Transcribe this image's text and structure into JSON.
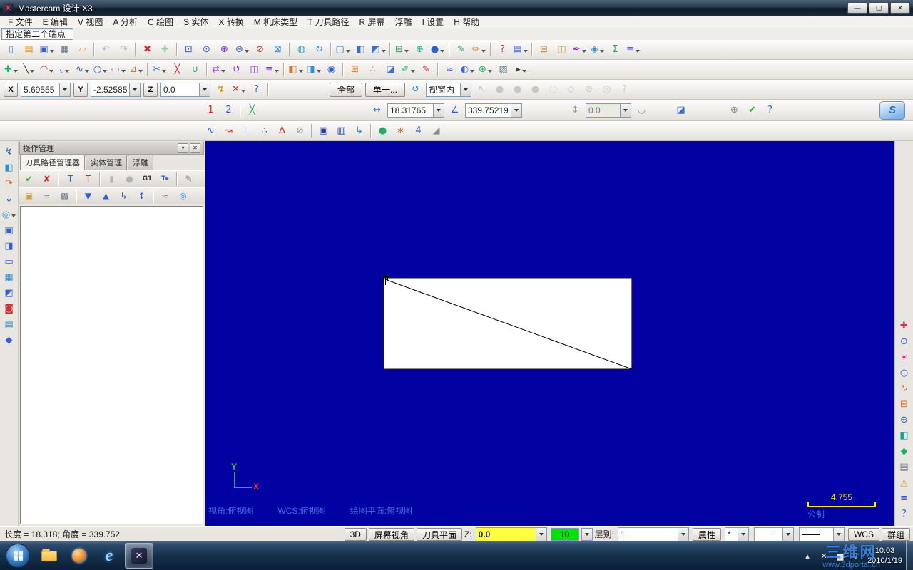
{
  "window": {
    "title": "Mastercam 设计 X3",
    "logo_glyph": "✕",
    "min_glyph": "—",
    "max_glyph": "▢",
    "close_glyph": "✕"
  },
  "menu": {
    "items": [
      "F 文件",
      "E 编辑",
      "V 视图",
      "A 分析",
      "C 绘图",
      "S 实体",
      "X 转换",
      "M 机床类型",
      "T 刀具路径",
      "R 屏幕",
      "浮雕",
      "I 设置",
      "H 帮助"
    ]
  },
  "prompt": {
    "text": "指定第二个端点"
  },
  "toolbars": {
    "standard": [
      {
        "name": "new-file-icon",
        "glyph": "▯",
        "color": "#6a86c2"
      },
      {
        "name": "open-file-icon",
        "glyph": "▤",
        "color": "#d79b3a"
      },
      {
        "name": "save-icon",
        "glyph": "▣",
        "color": "#3a5fd7",
        "drop": true
      },
      {
        "name": "print-icon",
        "glyph": "▦",
        "color": "#6b7b8c"
      },
      {
        "name": "file-merge-icon",
        "glyph": "▱",
        "color": "#c9a23a"
      },
      {
        "sep": true
      },
      {
        "name": "undo-icon",
        "glyph": "↶",
        "color": "#7a7a7a",
        "disabled": true
      },
      {
        "name": "redo-icon",
        "glyph": "↷",
        "color": "#7a7a7a",
        "disabled": true
      },
      {
        "sep": true
      },
      {
        "name": "delete-entities-icon",
        "glyph": "✖",
        "color": "#cc2a2a"
      },
      {
        "name": "undelete-icon",
        "glyph": "✚",
        "color": "#2fa05f",
        "disabled": true
      },
      {
        "sep": true
      },
      {
        "name": "zoom-window-icon",
        "glyph": "⊡",
        "color": "#2f5fd0"
      },
      {
        "name": "zoom-target-icon",
        "glyph": "⊙",
        "color": "#2f5fd0"
      },
      {
        "name": "zoom-in-icon",
        "glyph": "⊕",
        "color": "#7b2fd0"
      },
      {
        "name": "zoom-out-icon",
        "glyph": "⊖",
        "color": "#2f5fd0",
        "drop": true
      },
      {
        "name": "unzoom-icon",
        "glyph": "⊘",
        "color": "#d02f2f"
      },
      {
        "name": "zoom-fit-icon",
        "glyph": "⊠",
        "color": "#2f8fd0"
      },
      {
        "sep": true
      },
      {
        "name": "repaint-icon",
        "glyph": "◍",
        "color": "#2fa0d0"
      },
      {
        "name": "regenerate-icon",
        "glyph": "↻",
        "color": "#2f8fd0"
      },
      {
        "sep": true
      },
      {
        "name": "gview-top-icon",
        "glyph": "▢",
        "color": "#3a6fd0",
        "drop": true
      },
      {
        "name": "gview-front-icon",
        "glyph": "◧",
        "color": "#3a6fd0"
      },
      {
        "name": "gview-iso-icon",
        "glyph": "◩",
        "color": "#3a6fd0",
        "drop": true
      },
      {
        "sep": true
      },
      {
        "name": "planes-icon",
        "glyph": "⊞",
        "color": "#2fa05f",
        "drop": true
      },
      {
        "name": "wcs-globe-icon",
        "glyph": "⊕",
        "color": "#18b08a"
      },
      {
        "name": "gview-sphere-icon",
        "glyph": "●",
        "color": "#2f5fd0",
        "drop": true
      },
      {
        "sep": true
      },
      {
        "name": "shading-icon",
        "glyph": "✎",
        "color": "#2fa05f"
      },
      {
        "name": "wireframe-icon",
        "glyph": "✏",
        "color": "#d0762f",
        "drop": true
      },
      {
        "sep": true
      },
      {
        "name": "analyze-position-icon",
        "glyph": "?",
        "color": "#d02f2f"
      },
      {
        "name": "analyze-entity-icon",
        "glyph": "▤",
        "color": "#3a6fd0",
        "drop": true
      },
      {
        "sep": true
      },
      {
        "name": "machine-group-properties-icon",
        "glyph": "⊟",
        "color": "#d0762f"
      },
      {
        "name": "stock-setup-icon",
        "glyph": "◫",
        "color": "#c9a23a"
      },
      {
        "name": "toolpath-editor-icon",
        "glyph": "✒",
        "color": "#8f2fd0",
        "drop": true
      },
      {
        "name": "verify-icon",
        "glyph": "◈",
        "color": "#2f8fd0",
        "drop": true
      },
      {
        "name": "sigma-icon",
        "glyph": "Σ",
        "color": "#1fae5f"
      },
      {
        "name": "toolbar-options-icon",
        "glyph": "≡",
        "color": "#3a6fd0",
        "drop": true
      }
    ],
    "sketcher": [
      {
        "name": "point-tool-icon",
        "glyph": "✚",
        "color": "#1fae5f",
        "drop": true
      },
      {
        "name": "line-tool-icon",
        "glyph": "╲",
        "color": "#333333",
        "drop": true
      },
      {
        "name": "arc-tool-icon",
        "glyph": "◠",
        "color": "#d02f2f",
        "drop": true
      },
      {
        "name": "fillet-tool-icon",
        "glyph": "◟",
        "color": "#2f5fd0",
        "drop": true
      },
      {
        "name": "spline-tool-icon",
        "glyph": "∿",
        "color": "#2f5fd0",
        "drop": true
      },
      {
        "name": "circle-tool-icon",
        "glyph": "○",
        "color": "#2f5fd0",
        "drop": true
      },
      {
        "name": "rectangle-tool-icon",
        "glyph": "▭",
        "color": "#8f5fd0",
        "drop": true
      },
      {
        "name": "drafting-tool-icon",
        "glyph": "⊿",
        "color": "#d0762f",
        "drop": true
      },
      {
        "sep": true
      },
      {
        "name": "trim-break-icon",
        "glyph": "✂",
        "color": "#3a6fd0",
        "drop": true
      },
      {
        "name": "break-icon",
        "glyph": "╳",
        "color": "#d02f2f"
      },
      {
        "name": "join-entities-icon",
        "glyph": "∪",
        "color": "#1fae5f"
      },
      {
        "sep": true
      },
      {
        "name": "xform-translate-icon",
        "glyph": "⇄",
        "color": "#8f2fd0",
        "drop": true
      },
      {
        "name": "xform-rotate-icon",
        "glyph": "↺",
        "color": "#8f2fd0"
      },
      {
        "name": "xform-mirror-icon",
        "glyph": "◫",
        "color": "#8f2fd0"
      },
      {
        "name": "xform-offset-icon",
        "glyph": "≡",
        "color": "#8f2fd0",
        "drop": true
      },
      {
        "sep": true
      },
      {
        "name": "surface-create-icon",
        "glyph": "◧",
        "color": "#d0762f",
        "drop": true
      },
      {
        "name": "solid-extrude-icon",
        "glyph": "◨",
        "color": "#2f8fd0",
        "drop": true
      },
      {
        "name": "solid-boolean-icon",
        "glyph": "◉",
        "color": "#2f5fd0"
      },
      {
        "sep": true
      },
      {
        "name": "autocursor-grid-icon",
        "glyph": "⊞",
        "color": "#d0762f"
      },
      {
        "name": "snap-settings-icon",
        "glyph": "∴",
        "color": "#c9a23a"
      },
      {
        "name": "arrow-select-icon",
        "glyph": "◪",
        "color": "#3a6fd0"
      },
      {
        "name": "attribute-pen-icon",
        "glyph": "✐",
        "color": "#1fae5f",
        "drop": true
      },
      {
        "name": "attribute-brush-icon",
        "glyph": "✎",
        "color": "#d02f2f"
      },
      {
        "sep": true
      },
      {
        "name": "levels-dialog-icon",
        "glyph": "≈",
        "color": "#2f5fd0"
      },
      {
        "name": "shade-toggle-icon",
        "glyph": "◐",
        "color": "#3a6fd0",
        "drop": true
      },
      {
        "name": "normals-icon",
        "glyph": "⊛",
        "color": "#1fae5f",
        "drop": true
      },
      {
        "name": "blank-entities-icon",
        "glyph": "▨",
        "color": "#6b7b8c"
      },
      {
        "name": "more-tools-icon",
        "glyph": "▸",
        "color": "#444444",
        "drop": true
      }
    ],
    "function": [
      {
        "name": "curve-create-icon",
        "glyph": "∿",
        "color": "#2f5fd0"
      },
      {
        "name": "curvature-analysis-icon",
        "glyph": "↝",
        "color": "#d02f2f"
      },
      {
        "name": "endpoint-join-icon",
        "glyph": "⊦",
        "color": "#2f5fd0"
      },
      {
        "name": "point-cloud-icon",
        "glyph": "∴",
        "color": "#3a6fd0"
      },
      {
        "name": "delta-check-icon",
        "glyph": "∆",
        "color": "#cc2a2a"
      },
      {
        "name": "null-filter-icon",
        "glyph": "⊘",
        "color": "#8a8a8a"
      },
      {
        "sep": true
      },
      {
        "name": "view-manager-icon",
        "glyph": "▣",
        "color": "#1f3f8f"
      },
      {
        "name": "plane-manager-icon",
        "glyph": "▥",
        "color": "#1f3f8f"
      },
      {
        "name": "flow-arrow-icon",
        "glyph": "↳",
        "color": "#2f8fd0"
      },
      {
        "sep": true
      },
      {
        "name": "render-sphere-icon",
        "glyph": "●",
        "color": "#1fae5f"
      },
      {
        "name": "burst-icon",
        "glyph": "∗",
        "color": "#d0762f"
      },
      {
        "name": "spline-degree-icon",
        "glyph": "4",
        "color": "#2f5fd0"
      },
      {
        "name": "corner-handle-icon",
        "glyph": "◢",
        "color": "#8a8a8a"
      }
    ]
  },
  "coord": {
    "x_label": "X",
    "x_value": "5.69555",
    "y_label": "Y",
    "y_value": "-2.52585",
    "z_label": "Z",
    "z_value": "0.0",
    "mid_icons": [
      {
        "name": "fastpoint-icon",
        "glyph": "↯",
        "color": "#cc8a00"
      },
      {
        "name": "autocursor-override-icon",
        "glyph": "✕",
        "color": "#cc2a2a",
        "drop": true
      },
      {
        "name": "autocursor-help-icon",
        "glyph": "?",
        "color": "#2f5fd0"
      }
    ],
    "all_label": "全部",
    "single_label": "单一...",
    "pre_window_icons": [
      {
        "name": "select-last-icon",
        "glyph": "↺",
        "color": "#2f8fd0"
      }
    ],
    "window_value": "视窗内",
    "selection_icons": [
      {
        "name": "in-window-mode-icon",
        "glyph": "↖",
        "color": "#8a8a8a",
        "disabled": true
      },
      {
        "name": "select-result-icon",
        "glyph": "●",
        "color": "#9a9a9a",
        "disabled": true
      },
      {
        "name": "select-group-icon",
        "glyph": "●",
        "color": "#9a9a9a",
        "disabled": true
      },
      {
        "name": "select-mask-icon",
        "glyph": "●",
        "color": "#9a9a9a",
        "disabled": true
      },
      {
        "name": "select-chain-icon",
        "glyph": "◌",
        "color": "#9a9a9a",
        "disabled": true
      },
      {
        "name": "select-polygon-icon",
        "glyph": "◇",
        "color": "#9a9a9a",
        "disabled": true
      },
      {
        "name": "select-invert-icon",
        "glyph": "⊘",
        "color": "#9a9a9a",
        "disabled": true
      },
      {
        "name": "select-verify-icon",
        "glyph": "◎",
        "color": "#9a9a9a",
        "disabled": true
      },
      {
        "name": "selection-help-icon",
        "glyph": "?",
        "color": "#9a9a9a",
        "disabled": true
      }
    ]
  },
  "ribbon": {
    "endpoint_icons": [
      {
        "name": "edit-endpoint1-icon",
        "glyph": "1",
        "color": "#cc2a2a"
      },
      {
        "name": "edit-endpoint2-icon",
        "glyph": "2",
        "color": "#2f5fd0"
      },
      {
        "sep": true
      },
      {
        "name": "multiline-toggle-icon",
        "glyph": "╳",
        "color": "#1fae5f"
      }
    ],
    "length_icon": [
      {
        "name": "length-lock-icon",
        "glyph": "↔",
        "color": "#2f5fd0"
      }
    ],
    "length_value": "18.31765",
    "angle_icon": [
      {
        "name": "angle-lock-icon",
        "glyph": "∠",
        "color": "#2f5fd0"
      }
    ],
    "angle_value": "339.75219",
    "offset_icon": [
      {
        "name": "vertical-lock-icon",
        "glyph": "↕",
        "color": "#9a9a9a"
      }
    ],
    "offset_value": "0.0",
    "post_offset_icons": [
      {
        "name": "tangent-toggle-icon",
        "glyph": "◡",
        "color": "#8a8a8a"
      }
    ],
    "surface_icons": [
      {
        "name": "apply-to-surface-icon",
        "glyph": "◪",
        "color": "#2f6fd0"
      }
    ],
    "end_icons": [
      {
        "name": "apply-button",
        "glyph": "⊕",
        "color": "#8a8a8a"
      },
      {
        "name": "ok-button",
        "glyph": "✔",
        "color": "#1fae1f"
      },
      {
        "name": "help-button",
        "glyph": "?",
        "color": "#2f5fd0"
      }
    ],
    "logo_glyph": "S"
  },
  "left_strip": [
    {
      "name": "zoom-dynamic-icon",
      "glyph": "↯",
      "color": "#2f5fd0"
    },
    {
      "name": "iso-cube-icon",
      "glyph": "◧",
      "color": "#2f8fd0"
    },
    {
      "name": "rotate-view-icon",
      "glyph": "↷",
      "color": "#cc6a2f"
    },
    {
      "name": "pan-down-icon",
      "glyph": "↓",
      "color": "#2f5fd0"
    },
    {
      "name": "cylinder-view-icon",
      "glyph": "◎",
      "color": "#2f8fd0",
      "drop": true
    },
    {
      "name": "front-view-icon",
      "glyph": "▣",
      "color": "#2f5fd0"
    },
    {
      "name": "right-view-icon",
      "glyph": "◨",
      "color": "#2f5fd0"
    },
    {
      "name": "top-view-icon",
      "glyph": "▭",
      "color": "#2f5fd0"
    },
    {
      "name": "grid-plane-icon",
      "glyph": "▦",
      "color": "#2f8fd0"
    },
    {
      "name": "corner-view-icon",
      "glyph": "◩",
      "color": "#2f5fd0"
    },
    {
      "name": "section-view-icon",
      "glyph": "◙",
      "color": "#cc2f2f"
    },
    {
      "name": "sheet-view-icon",
      "glyph": "▤",
      "color": "#2f8fd0"
    },
    {
      "name": "diamond-view-icon",
      "glyph": "◆",
      "color": "#2f5fd0"
    }
  ],
  "right_strip": [
    {
      "name": "art-add-surface-icon",
      "glyph": "✚",
      "color": "#cc2f6a"
    },
    {
      "name": "art-zoom-icon",
      "glyph": "⊙",
      "color": "#2f5fd0"
    },
    {
      "name": "art-star-icon",
      "glyph": "∗",
      "color": "#d02f8f"
    },
    {
      "name": "art-circle-icon",
      "glyph": "○",
      "color": "#2f5fd0"
    },
    {
      "name": "art-wave-icon",
      "glyph": "∿",
      "color": "#cc6a2f"
    },
    {
      "name": "art-grid-icon",
      "glyph": "⊞",
      "color": "#d0762f"
    },
    {
      "name": "art-target-icon",
      "glyph": "⊕",
      "color": "#2f5fd0"
    },
    {
      "name": "art-shade-icon",
      "glyph": "◧",
      "color": "#18a0a0"
    },
    {
      "name": "art-leaf-icon",
      "glyph": "◆",
      "color": "#1fae5f"
    },
    {
      "name": "art-layers-icon",
      "glyph": "▤",
      "color": "#6b7b8c"
    },
    {
      "name": "art-triangle-icon",
      "glyph": "◬",
      "color": "#c9a23a"
    },
    {
      "name": "art-list-icon",
      "glyph": "≡",
      "color": "#2f5fd0"
    },
    {
      "name": "art-help-icon",
      "glyph": "?",
      "color": "#2f5fd0"
    }
  ],
  "ops_panel": {
    "title": "操作管理",
    "collapse_glyph": "▾",
    "close_glyph": "✕",
    "tabs": [
      "刀具路径管理器",
      "实体管理",
      "浮雕"
    ],
    "toolbar1": [
      {
        "name": "select-all-operations-icon",
        "glyph": "✔",
        "color": "#1fae1f"
      },
      {
        "name": "unselect-all-operations-icon",
        "glyph": "✘",
        "color": "#cc2a2a"
      },
      {
        "sep": true
      },
      {
        "name": "regen-selected-icon",
        "glyph": "T",
        "color": "#2f5fd0"
      },
      {
        "name": "regen-dirty-icon",
        "glyph": "T",
        "color": "#cc2a2a"
      },
      {
        "sep": true
      },
      {
        "name": "backplot-icon",
        "glyph": "▮",
        "color": "#6b7b8c",
        "disabled": true
      },
      {
        "name": "verify-solid-icon",
        "glyph": "●",
        "color": "#6b7b8c",
        "disabled": true
      },
      {
        "name": "post-icon",
        "glyph": "G1",
        "color": "#333333"
      },
      {
        "name": "highfeed-icon",
        "glyph": "T▸",
        "color": "#2f5fd0"
      },
      {
        "sep": true
      },
      {
        "name": "toolpath-config-icon",
        "glyph": "✎",
        "color": "#6b7b8c"
      }
    ],
    "toolbar2": [
      {
        "name": "lock-selected-icon",
        "glyph": "▣",
        "color": "#c9a23a"
      },
      {
        "name": "toggle-toolpath-display-icon",
        "glyph": "≈",
        "color": "#6b7b8c"
      },
      {
        "name": "lock-all-icon",
        "glyph": "▩",
        "color": "#6b7b8c"
      },
      {
        "sep": true
      },
      {
        "name": "move-insert-down-icon",
        "glyph": "▼",
        "color": "#2f5fd0"
      },
      {
        "name": "move-insert-up-icon",
        "glyph": "▲",
        "color": "#2f5fd0"
      },
      {
        "name": "insert-indent-icon",
        "glyph": "↳",
        "color": "#2f5fd0"
      },
      {
        "name": "scroll-insert-icon",
        "glyph": "↕",
        "color": "#2f5fd0"
      },
      {
        "sep": true
      },
      {
        "name": "filter-display-icon",
        "glyph": "≈",
        "color": "#2f8fd0"
      },
      {
        "name": "display-options-icon",
        "glyph": "◎",
        "color": "#2f8fd0"
      }
    ]
  },
  "drawing": {
    "gview_label": "视角:俯视图",
    "wcs_label": "WCS:俯视图",
    "cplane_label": "绘图平面:俯视图",
    "axis_x": "X",
    "axis_y": "Y",
    "scale_value": "4.755",
    "scale_units": "公制"
  },
  "status_bar": {
    "readout": "长度 = 18.318; 角度 = 339.752",
    "btn_3d": "3D",
    "btn_gview": "屏幕视角",
    "btn_plane": "刀具平面",
    "z_label": "Z:",
    "z_value": "0.0",
    "color_value": "10",
    "level_label": "层别:",
    "level_value": "1",
    "attr_label": "属性",
    "point_style": "*",
    "wcs_label": "WCS",
    "group_label": "群组"
  },
  "taskbar": {
    "time": "10:03",
    "date": "2010/1/19",
    "ie_glyph": "e",
    "mcx_glyph": "✕",
    "tray": [
      {
        "name": "tray-show-hidden-icon",
        "glyph": "▴",
        "color": "#e8e8e8"
      },
      {
        "name": "tray-app-icon",
        "glyph": "✕",
        "color": "#e8e8e8"
      },
      {
        "name": "tray-network-icon",
        "glyph": "▆",
        "color": "#e8e8e8"
      },
      {
        "name": "tray-volume-icon",
        "glyph": "♪",
        "color": "#e8e8e8"
      }
    ]
  },
  "watermark": {
    "line1": "三维网",
    "line2": "www.3dportal.cn"
  }
}
